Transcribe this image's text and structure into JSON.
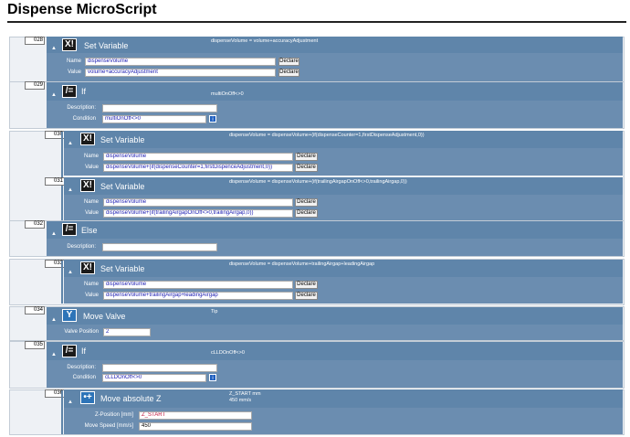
{
  "page": {
    "title": "Dispense MicroScript"
  },
  "rows": [
    {
      "num": "028",
      "title": "Set Variable",
      "summary": "dispenseVolume = volume+accuracyAdjustment",
      "name": "dispenseVolume",
      "value": "volume+accuracyAdjustment"
    },
    {
      "num": "029",
      "title": "If",
      "summary": "multiOnOff<>0",
      "description": "",
      "condition": "multiOnOff<>0"
    },
    {
      "num": "030",
      "title": "Set Variable",
      "summary": "dispenseVolume = dispenseVolume+(if(dispenseCounter=1,firstDispenseAdjustment,0))",
      "name": "dispenseVolume",
      "value": "dispenseVolume+(if(dispenseCounter=1,firstDispenceAdjustment,0))"
    },
    {
      "num": "031",
      "title": "Set Variable",
      "summary": "dispenseVolume = dispenseVolume+(if(trailingAirgapOnOff<>0,trailingAirgap,0))",
      "name": "dispenseVolume",
      "value": "dispenseVolume+(if(trailingAirgapOnOff<>0,trailingAirgap,0))"
    },
    {
      "num": "032",
      "title": "Else",
      "description": ""
    },
    {
      "num": "033",
      "title": "Set Variable",
      "summary": "dispenseVolume = dispenseVolume+trailingAirgap+leadingAirgap",
      "name": "dispenseVolume",
      "value": "dispenseVolume+trailingAirgap+leadingAirgap"
    },
    {
      "num": "034",
      "title": "Move Valve",
      "summary": "Tip",
      "position_label": "Valve Position",
      "position": "2"
    },
    {
      "num": "035",
      "title": "If",
      "summary": "cLLDOnOff<>0",
      "description": "",
      "condition": "cLLDOnOff<>0"
    },
    {
      "num": "036",
      "title": "Move absolute Z",
      "summary": "Z_START mm\n450 mm/s",
      "zpos_label": "Z-Position [mm]",
      "zpos": "Z_START",
      "speed_label": "Move Speed [mm/s]",
      "speed": "450"
    }
  ],
  "labels": {
    "name": "Name",
    "value": "Value",
    "declare": "Declare",
    "description": "Description:",
    "condition": "Condition",
    "collapse": "▲"
  },
  "icons": {
    "setvar": "X!",
    "if": "/=",
    "else": "/=",
    "valve": "Y",
    "movez": "•+"
  }
}
